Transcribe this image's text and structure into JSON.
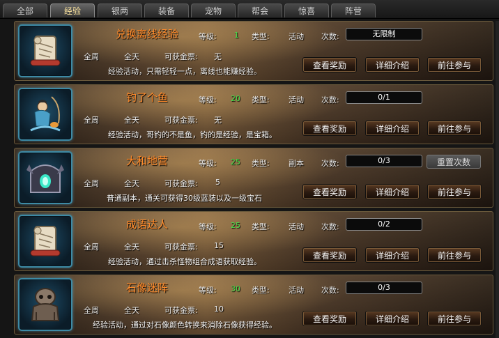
{
  "tabs": [
    "全部",
    "经验",
    "银两",
    "装备",
    "宠物",
    "帮会",
    "惊喜",
    "阵营"
  ],
  "active_tab": "经验",
  "labels": {
    "level": "等级:",
    "type": "类型:",
    "count": "次数:",
    "reward_ticket": "可获金票:",
    "view_reward": "查看奖励",
    "details": "详细介绍",
    "go_join": "前往参与",
    "reset_count": "重置次数"
  },
  "activities": [
    {
      "name": "兑换离线经验",
      "level": "1",
      "type": "活动",
      "count": "无限制",
      "week": "全周",
      "day": "全天",
      "ticket": "无",
      "desc": "经验活动，只需轻轻一点，离线也能赚经验。",
      "icon": "scroll-icon",
      "has_reset": false
    },
    {
      "name": "钓了个鱼",
      "level": "20",
      "type": "活动",
      "count": "0/1",
      "week": "全周",
      "day": "全天",
      "ticket": "无",
      "desc": "经验活动，哥钓的不是鱼，钓的是经验，是宝箱。",
      "icon": "fisher-icon",
      "has_reset": false
    },
    {
      "name": "大和地营",
      "level": "25",
      "type": "副本",
      "count": "0/3",
      "week": "全周",
      "day": "全天",
      "ticket": "5",
      "desc": "普通副本，通关可获得30级蓝装以及一级宝石",
      "icon": "dungeon-gate-icon",
      "has_reset": true
    },
    {
      "name": "成语达人",
      "level": "25",
      "type": "活动",
      "count": "0/2",
      "week": "全周",
      "day": "全天",
      "ticket": "15",
      "desc": "经验活动，通过击杀怪物组合成语获取经验。",
      "icon": "scroll-icon",
      "has_reset": false
    },
    {
      "name": "石像迷阵",
      "level": "30",
      "type": "活动",
      "count": "0/3",
      "week": "全周",
      "day": "全天",
      "ticket": "10",
      "desc": "经验活动，通过对石像颜色转换来消除石像获得经验。",
      "icon": "stone-statue-icon",
      "has_reset": false
    }
  ]
}
